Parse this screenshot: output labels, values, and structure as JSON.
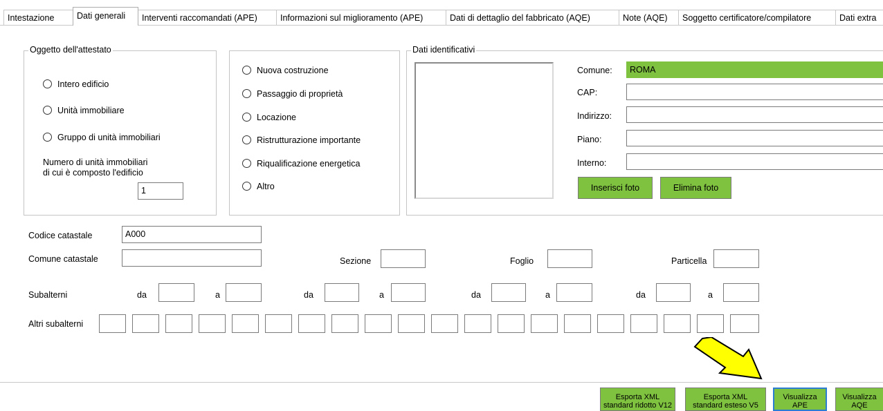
{
  "tabs": [
    {
      "label": "Intestazione"
    },
    {
      "label": "Dati generali"
    },
    {
      "label": "Interventi raccomandati (APE)"
    },
    {
      "label": "Informazioni sul miglioramento (APE)"
    },
    {
      "label": "Dati di dettaglio del fabbricato (AQE)"
    },
    {
      "label": "Note (AQE)"
    },
    {
      "label": "Soggetto certificatore/compilatore"
    },
    {
      "label": "Dati extra"
    }
  ],
  "active_tab": "Dati generali",
  "oggetto": {
    "title": "Oggetto dell'attestato",
    "options": [
      "Intero edificio",
      "Unità immobiliare",
      "Gruppo di unità immobiliari"
    ],
    "num_label_1": "Numero di unità immobiliari",
    "num_label_2": "di cui è composto l'edificio",
    "num_value": "1"
  },
  "motivazione": {
    "options": [
      "Nuova costruzione",
      "Passaggio di proprietà",
      "Locazione",
      "Ristrutturazione importante",
      "Riqualificazione energetica",
      "Altro"
    ]
  },
  "identificativi": {
    "title": "Dati identificativi",
    "comune_label": "Comune:",
    "comune_value": "ROMA",
    "cap_label": "CAP:",
    "cap_value": "",
    "indirizzo_label": "Indirizzo:",
    "indirizzo_value": "",
    "piano_label": "Piano:",
    "piano_value": "",
    "interno_label": "Interno:",
    "interno_value": "",
    "inserisci_foto": "Inserisci foto",
    "elimina_foto": "Elimina foto"
  },
  "catasto": {
    "codice_label": "Codice catastale",
    "codice_value": "A000",
    "comune_label": "Comune catastale",
    "comune_value": "",
    "sezione_label": "Sezione",
    "foglio_label": "Foglio",
    "particella_label": "Particella",
    "subalterni_label": "Subalterni",
    "da_label": "da",
    "a_label": "a",
    "altri_label": "Altri subalterni"
  },
  "bottom_buttons": {
    "xml_ridotto_1": "Esporta XML",
    "xml_ridotto_2": "standard ridotto V12",
    "xml_esteso_1": "Esporta XML",
    "xml_esteso_2": "standard esteso V5",
    "vis_ape_1": "Visualizza",
    "vis_ape_2": "APE",
    "vis_aqe_1": "Visualizza",
    "vis_aqe_2": "AQE"
  },
  "colors": {
    "green": "#7fc23f",
    "arrow_fill": "#ffff00",
    "focus_blue": "#2b7cd3"
  },
  "annotation": "arrow-icon pointing at Visualizza APE button"
}
